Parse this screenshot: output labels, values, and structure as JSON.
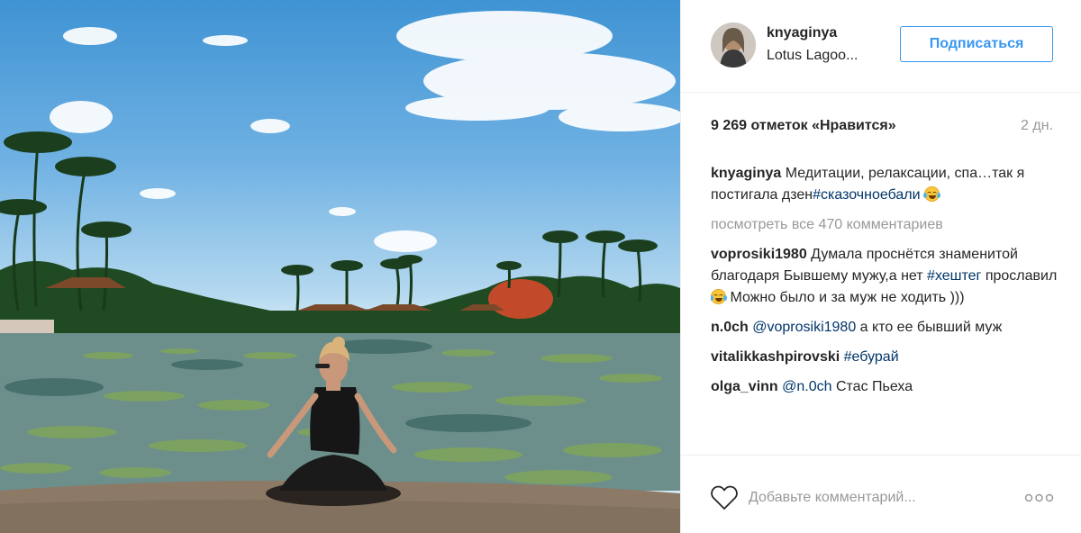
{
  "post": {
    "username": "knyaginya",
    "location": "Lotus Lagoo...",
    "follow_label": "Подписаться",
    "likes": "9 269 отметок «Нравится»",
    "time": "2 дн.",
    "caption": {
      "user": "knyaginya",
      "text": " Медитации, релаксации, спа…так я постигала дзен",
      "tag": "#сказочноебали",
      "emoji": "face-with-tears-of-joy"
    },
    "view_all": "посмотреть все 470 комментариев",
    "comments": [
      {
        "user": "voprosiki1980",
        "text1": " Думала проснётся знаменитой благодаря Бывшему мужу,а нет ",
        "tag": "#хештег",
        "text2": " прославил ",
        "text3": " Можно было и за муж не ходить )))"
      },
      {
        "user": "n.0ch",
        "mention": "@voprosiki1980",
        "text": " а кто ее бывший муж"
      },
      {
        "user": "vitalikkashpirovski",
        "tag": "#ебурай"
      },
      {
        "user": "olga_vinn",
        "mention": "@n.0ch",
        "text": " Стас Пьеха"
      }
    ],
    "add_comment_placeholder": "Добавьте комментарий..."
  },
  "icons": {
    "like": "heart-icon",
    "options": "more-options-icon"
  },
  "colors": {
    "accent": "#3897f0",
    "text": "#262626",
    "muted": "#999999",
    "link": "#003569"
  }
}
